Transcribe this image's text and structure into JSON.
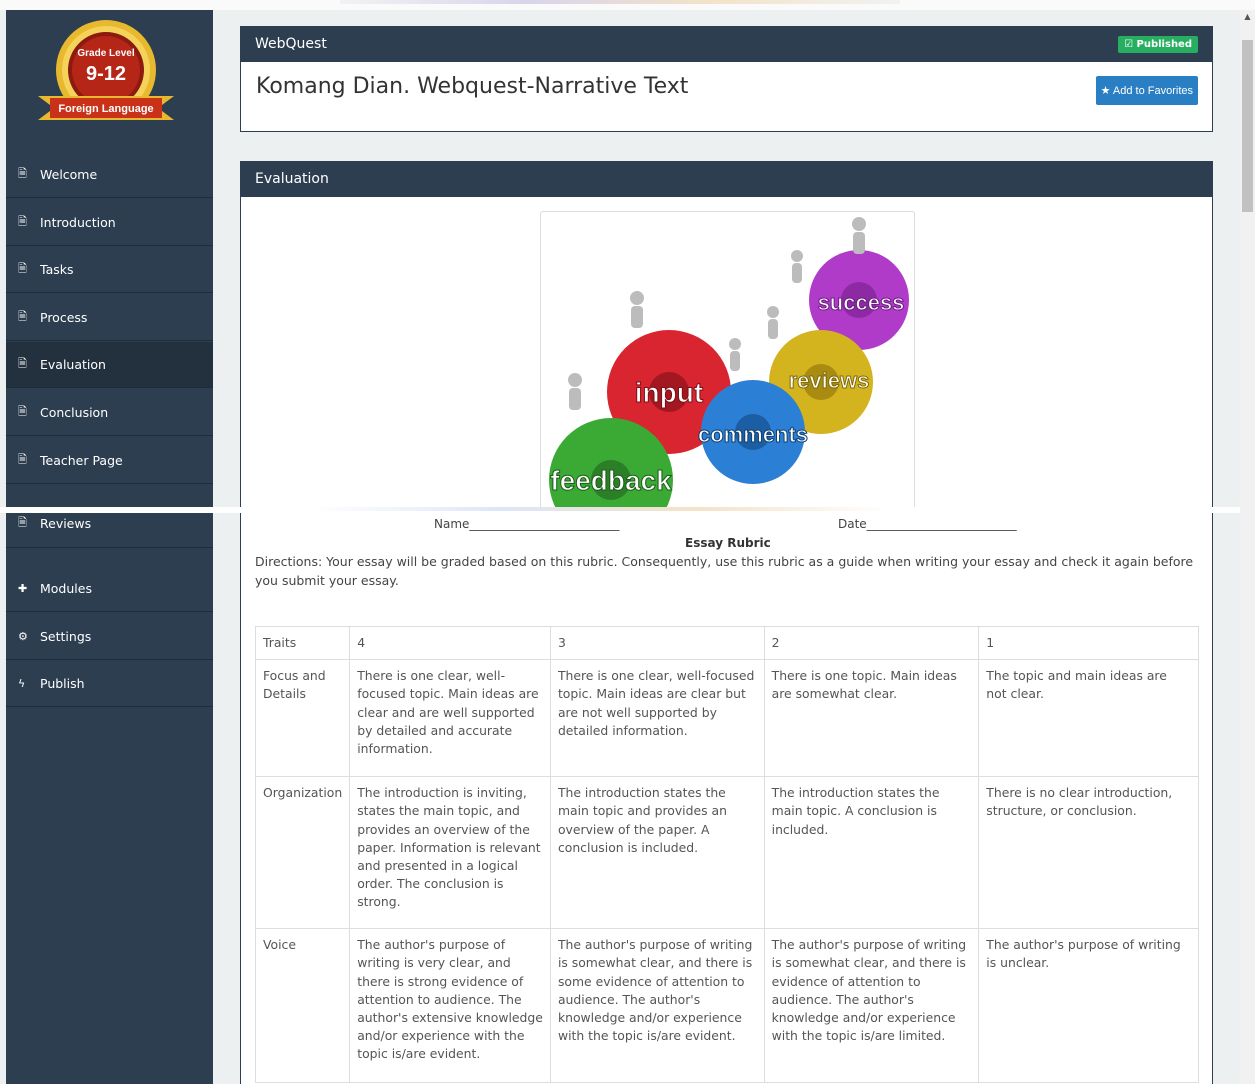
{
  "badge": {
    "top": "Grade Level",
    "grade": "9-12",
    "ribbon": "Foreign Language"
  },
  "sidebar": {
    "items": [
      {
        "label": "Welcome",
        "icon": "document-icon"
      },
      {
        "label": "Introduction",
        "icon": "document-icon"
      },
      {
        "label": "Tasks",
        "icon": "document-icon"
      },
      {
        "label": "Process",
        "icon": "document-icon"
      },
      {
        "label": "Evaluation",
        "icon": "document-icon",
        "active": true
      },
      {
        "label": "Conclusion",
        "icon": "document-icon"
      },
      {
        "label": "Teacher Page",
        "icon": "document-icon"
      },
      {
        "label": "Reviews",
        "icon": "document-icon"
      },
      {
        "label": "Modules",
        "icon": "plus-icon"
      },
      {
        "label": "Settings",
        "icon": "gear-icon"
      },
      {
        "label": "Publish",
        "icon": "bolt-icon"
      }
    ],
    "icons": {
      "document": "🗎",
      "plus": "✚",
      "gear": "⚙",
      "bolt": "ϟ"
    }
  },
  "header": {
    "section": "WebQuest",
    "status": "☑ Published",
    "title": "Komang Dian. Webquest-Narrative Text",
    "favorites": "★ Add to Favorites"
  },
  "evaluation": {
    "heading": "Evaluation",
    "image_words": [
      "success",
      "reviews",
      "input",
      "comments",
      "feedback"
    ],
    "name_line": "Name_________________________",
    "date_line": "Date_________________________",
    "rubric_title": "Essay Rubric",
    "directions": "Directions: Your essay will be graded based on this rubric. Consequently, use this rubric as a guide when writing your essay and check it again before you submit your essay.",
    "table": {
      "header": [
        "Traits",
        "4",
        "3",
        "2",
        "1"
      ],
      "rows": [
        [
          "Focus and Details",
          "There is one clear, well-focused topic. Main ideas are clear and are well supported by detailed and accurate information.",
          "There is one clear, well-focused topic. Main ideas are clear but are not well supported by detailed information.",
          "There is one topic. Main ideas are somewhat clear.",
          "The topic and main ideas are not clear."
        ],
        [
          "Organization",
          "The introduction is inviting, states the main topic, and provides an overview of the paper. Information is relevant and presented in a logical order. The conclusion is strong.",
          "The introduction states the main topic and provides an overview of the paper. A conclusion is included.",
          "The introduction states the main topic. A conclusion is included.",
          "There is no clear introduction, structure, or conclusion."
        ],
        [
          "Voice",
          "The author's purpose of writing is very clear, and there is strong evidence of attention to audience. The author's extensive knowledge and/or experience with the topic is/are evident.",
          "The author's purpose of writing is somewhat clear, and there is some evidence of attention to audience. The author's knowledge and/or experience with the topic is/are evident.",
          "The author's purpose of writing is somewhat clear, and there is evidence of attention to audience. The author's knowledge and/or experience with the topic is/are limited.",
          "The author's purpose of writing is unclear."
        ]
      ]
    }
  },
  "colors": {
    "sidebar": "#2c3e50",
    "published": "#27ae60",
    "button": "#2a7fc4"
  }
}
